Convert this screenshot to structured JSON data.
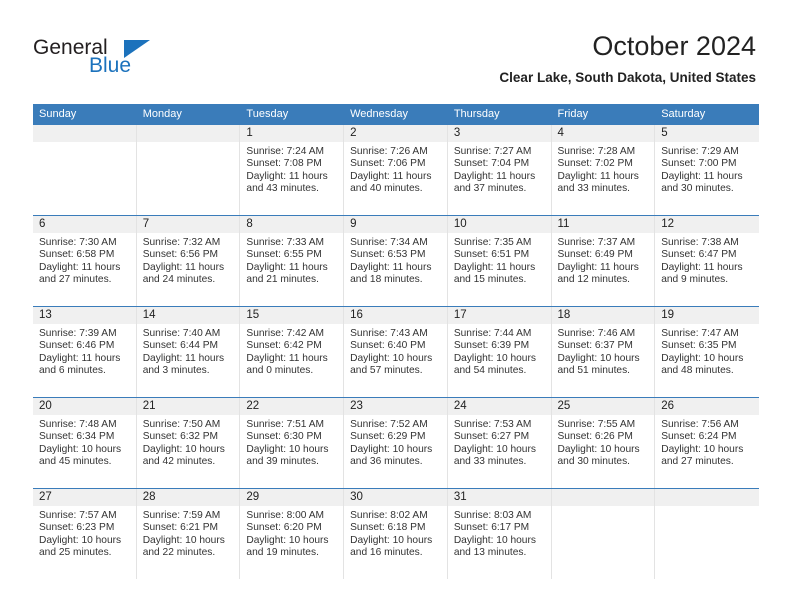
{
  "brand": {
    "name_part1": "General",
    "name_part2": "Blue"
  },
  "header": {
    "title": "October 2024",
    "subtitle": "Clear Lake, South Dakota, United States"
  },
  "colors": {
    "header_blue": "#3a7cba",
    "logo_blue": "#1c72bc",
    "day_band": "#f0f0f0",
    "grid_line": "#e3e3e3"
  },
  "weekdays": [
    "Sunday",
    "Monday",
    "Tuesday",
    "Wednesday",
    "Thursday",
    "Friday",
    "Saturday"
  ],
  "weeks": [
    [
      {
        "day": "",
        "sunrise": "",
        "sunset": "",
        "daylight": "",
        "empty": true
      },
      {
        "day": "",
        "sunrise": "",
        "sunset": "",
        "daylight": "",
        "empty": true
      },
      {
        "day": "1",
        "sunrise": "Sunrise: 7:24 AM",
        "sunset": "Sunset: 7:08 PM",
        "daylight": "Daylight: 11 hours and 43 minutes."
      },
      {
        "day": "2",
        "sunrise": "Sunrise: 7:26 AM",
        "sunset": "Sunset: 7:06 PM",
        "daylight": "Daylight: 11 hours and 40 minutes."
      },
      {
        "day": "3",
        "sunrise": "Sunrise: 7:27 AM",
        "sunset": "Sunset: 7:04 PM",
        "daylight": "Daylight: 11 hours and 37 minutes."
      },
      {
        "day": "4",
        "sunrise": "Sunrise: 7:28 AM",
        "sunset": "Sunset: 7:02 PM",
        "daylight": "Daylight: 11 hours and 33 minutes."
      },
      {
        "day": "5",
        "sunrise": "Sunrise: 7:29 AM",
        "sunset": "Sunset: 7:00 PM",
        "daylight": "Daylight: 11 hours and 30 minutes."
      }
    ],
    [
      {
        "day": "6",
        "sunrise": "Sunrise: 7:30 AM",
        "sunset": "Sunset: 6:58 PM",
        "daylight": "Daylight: 11 hours and 27 minutes."
      },
      {
        "day": "7",
        "sunrise": "Sunrise: 7:32 AM",
        "sunset": "Sunset: 6:56 PM",
        "daylight": "Daylight: 11 hours and 24 minutes."
      },
      {
        "day": "8",
        "sunrise": "Sunrise: 7:33 AM",
        "sunset": "Sunset: 6:55 PM",
        "daylight": "Daylight: 11 hours and 21 minutes."
      },
      {
        "day": "9",
        "sunrise": "Sunrise: 7:34 AM",
        "sunset": "Sunset: 6:53 PM",
        "daylight": "Daylight: 11 hours and 18 minutes."
      },
      {
        "day": "10",
        "sunrise": "Sunrise: 7:35 AM",
        "sunset": "Sunset: 6:51 PM",
        "daylight": "Daylight: 11 hours and 15 minutes."
      },
      {
        "day": "11",
        "sunrise": "Sunrise: 7:37 AM",
        "sunset": "Sunset: 6:49 PM",
        "daylight": "Daylight: 11 hours and 12 minutes."
      },
      {
        "day": "12",
        "sunrise": "Sunrise: 7:38 AM",
        "sunset": "Sunset: 6:47 PM",
        "daylight": "Daylight: 11 hours and 9 minutes."
      }
    ],
    [
      {
        "day": "13",
        "sunrise": "Sunrise: 7:39 AM",
        "sunset": "Sunset: 6:46 PM",
        "daylight": "Daylight: 11 hours and 6 minutes."
      },
      {
        "day": "14",
        "sunrise": "Sunrise: 7:40 AM",
        "sunset": "Sunset: 6:44 PM",
        "daylight": "Daylight: 11 hours and 3 minutes."
      },
      {
        "day": "15",
        "sunrise": "Sunrise: 7:42 AM",
        "sunset": "Sunset: 6:42 PM",
        "daylight": "Daylight: 11 hours and 0 minutes."
      },
      {
        "day": "16",
        "sunrise": "Sunrise: 7:43 AM",
        "sunset": "Sunset: 6:40 PM",
        "daylight": "Daylight: 10 hours and 57 minutes."
      },
      {
        "day": "17",
        "sunrise": "Sunrise: 7:44 AM",
        "sunset": "Sunset: 6:39 PM",
        "daylight": "Daylight: 10 hours and 54 minutes."
      },
      {
        "day": "18",
        "sunrise": "Sunrise: 7:46 AM",
        "sunset": "Sunset: 6:37 PM",
        "daylight": "Daylight: 10 hours and 51 minutes."
      },
      {
        "day": "19",
        "sunrise": "Sunrise: 7:47 AM",
        "sunset": "Sunset: 6:35 PM",
        "daylight": "Daylight: 10 hours and 48 minutes."
      }
    ],
    [
      {
        "day": "20",
        "sunrise": "Sunrise: 7:48 AM",
        "sunset": "Sunset: 6:34 PM",
        "daylight": "Daylight: 10 hours and 45 minutes."
      },
      {
        "day": "21",
        "sunrise": "Sunrise: 7:50 AM",
        "sunset": "Sunset: 6:32 PM",
        "daylight": "Daylight: 10 hours and 42 minutes."
      },
      {
        "day": "22",
        "sunrise": "Sunrise: 7:51 AM",
        "sunset": "Sunset: 6:30 PM",
        "daylight": "Daylight: 10 hours and 39 minutes."
      },
      {
        "day": "23",
        "sunrise": "Sunrise: 7:52 AM",
        "sunset": "Sunset: 6:29 PM",
        "daylight": "Daylight: 10 hours and 36 minutes."
      },
      {
        "day": "24",
        "sunrise": "Sunrise: 7:53 AM",
        "sunset": "Sunset: 6:27 PM",
        "daylight": "Daylight: 10 hours and 33 minutes."
      },
      {
        "day": "25",
        "sunrise": "Sunrise: 7:55 AM",
        "sunset": "Sunset: 6:26 PM",
        "daylight": "Daylight: 10 hours and 30 minutes."
      },
      {
        "day": "26",
        "sunrise": "Sunrise: 7:56 AM",
        "sunset": "Sunset: 6:24 PM",
        "daylight": "Daylight: 10 hours and 27 minutes."
      }
    ],
    [
      {
        "day": "27",
        "sunrise": "Sunrise: 7:57 AM",
        "sunset": "Sunset: 6:23 PM",
        "daylight": "Daylight: 10 hours and 25 minutes."
      },
      {
        "day": "28",
        "sunrise": "Sunrise: 7:59 AM",
        "sunset": "Sunset: 6:21 PM",
        "daylight": "Daylight: 10 hours and 22 minutes."
      },
      {
        "day": "29",
        "sunrise": "Sunrise: 8:00 AM",
        "sunset": "Sunset: 6:20 PM",
        "daylight": "Daylight: 10 hours and 19 minutes."
      },
      {
        "day": "30",
        "sunrise": "Sunrise: 8:02 AM",
        "sunset": "Sunset: 6:18 PM",
        "daylight": "Daylight: 10 hours and 16 minutes."
      },
      {
        "day": "31",
        "sunrise": "Sunrise: 8:03 AM",
        "sunset": "Sunset: 6:17 PM",
        "daylight": "Daylight: 10 hours and 13 minutes."
      },
      {
        "day": "",
        "sunrise": "",
        "sunset": "",
        "daylight": "",
        "empty": true
      },
      {
        "day": "",
        "sunrise": "",
        "sunset": "",
        "daylight": "",
        "empty": true
      }
    ]
  ]
}
